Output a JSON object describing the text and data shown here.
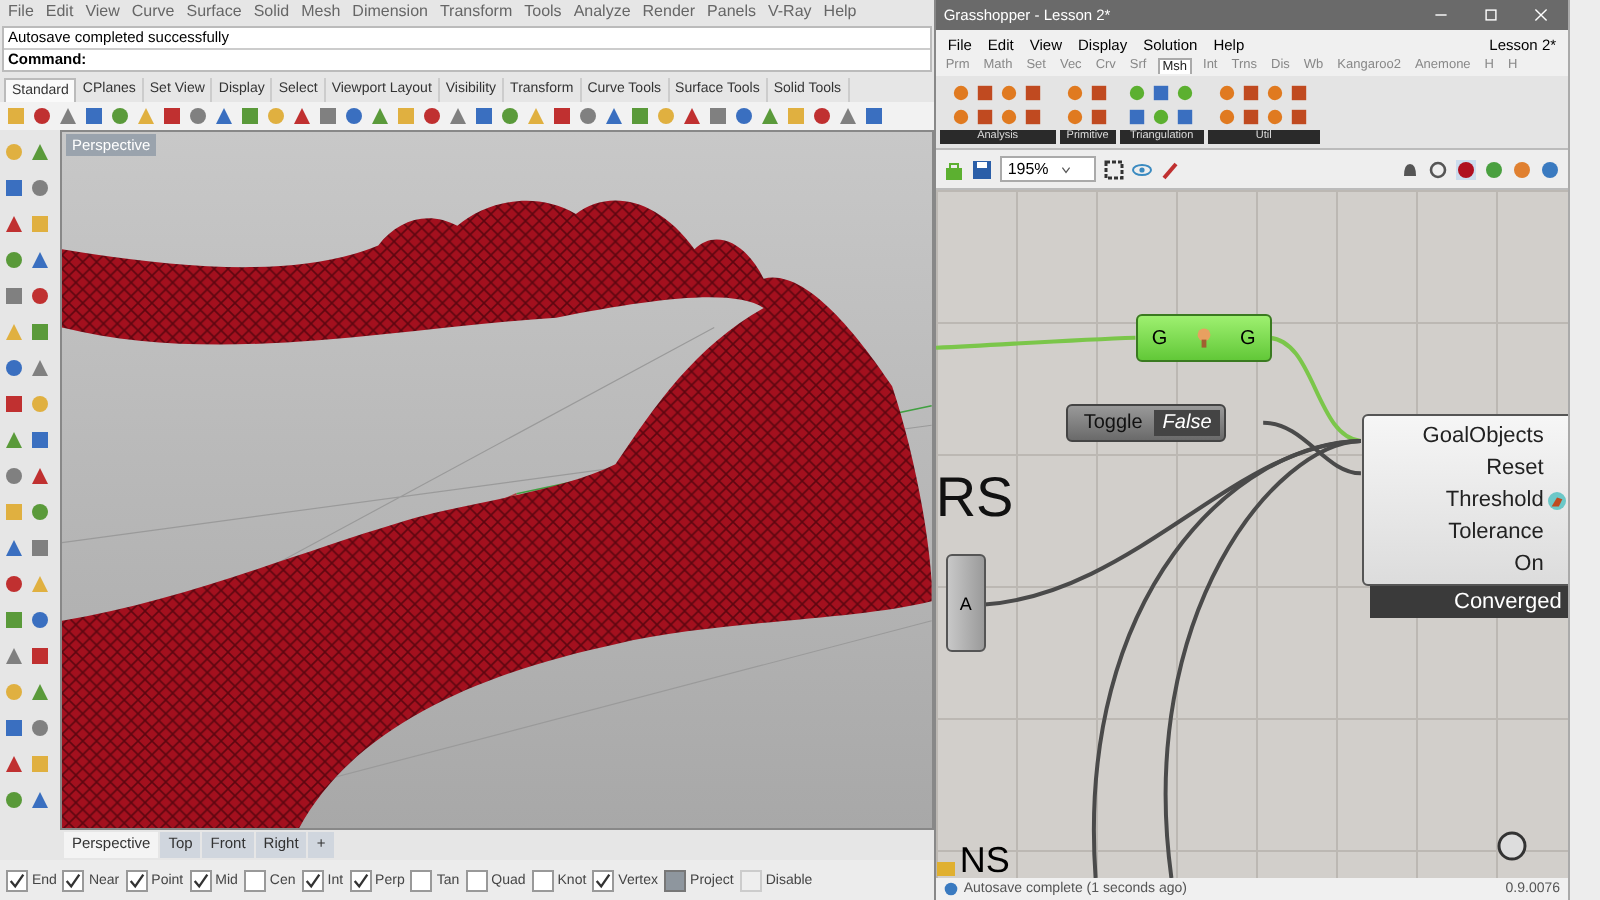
{
  "rhino": {
    "menu": [
      "File",
      "Edit",
      "View",
      "Curve",
      "Surface",
      "Solid",
      "Mesh",
      "Dimension",
      "Transform",
      "Tools",
      "Analyze",
      "Render",
      "Panels",
      "V-Ray",
      "Help"
    ],
    "command_history": "Autosave completed successfully",
    "command_prompt": "Command:",
    "toolbar_tabs": [
      {
        "label": "Standard",
        "selected": true
      },
      {
        "label": "CPlanes",
        "selected": false
      },
      {
        "label": "Set View",
        "selected": false
      },
      {
        "label": "Display",
        "selected": false
      },
      {
        "label": "Select",
        "selected": false
      },
      {
        "label": "Viewport Layout",
        "selected": false
      },
      {
        "label": "Visibility",
        "selected": false
      },
      {
        "label": "Transform",
        "selected": false
      },
      {
        "label": "Curve Tools",
        "selected": false
      },
      {
        "label": "Surface Tools",
        "selected": false
      },
      {
        "label": "Solid Tools",
        "selected": false
      }
    ],
    "viewport": {
      "title": "Perspective"
    },
    "viewport_tabs": [
      {
        "label": "Perspective",
        "selected": true
      },
      {
        "label": "Top",
        "selected": false
      },
      {
        "label": "Front",
        "selected": false
      },
      {
        "label": "Right",
        "selected": false
      },
      {
        "label": "+",
        "selected": false
      }
    ],
    "osnaps": [
      {
        "label": "End",
        "checked": true,
        "kind": "checkbox"
      },
      {
        "label": "Near",
        "checked": true,
        "kind": "checkbox"
      },
      {
        "label": "Point",
        "checked": true,
        "kind": "checkbox"
      },
      {
        "label": "Mid",
        "checked": true,
        "kind": "checkbox"
      },
      {
        "label": "Cen",
        "checked": false,
        "kind": "checkbox"
      },
      {
        "label": "Int",
        "checked": true,
        "kind": "checkbox"
      },
      {
        "label": "Perp",
        "checked": true,
        "kind": "checkbox"
      },
      {
        "label": "Tan",
        "checked": false,
        "kind": "checkbox"
      },
      {
        "label": "Quad",
        "checked": false,
        "kind": "checkbox"
      },
      {
        "label": "Knot",
        "checked": false,
        "kind": "checkbox"
      },
      {
        "label": "Vertex",
        "checked": true,
        "kind": "checkbox"
      },
      {
        "label": "Project",
        "checked": true,
        "kind": "toggle"
      },
      {
        "label": "Disable",
        "checked": false,
        "kind": "toggle"
      }
    ]
  },
  "grasshopper": {
    "title": "Grasshopper - Lesson 2*",
    "menu": [
      "File",
      "Edit",
      "View",
      "Display",
      "Solution",
      "Help"
    ],
    "document": "Lesson 2*",
    "tabs": [
      {
        "label": "Prm",
        "selected": false
      },
      {
        "label": "Math",
        "selected": false
      },
      {
        "label": "Set",
        "selected": false
      },
      {
        "label": "Vec",
        "selected": false
      },
      {
        "label": "Crv",
        "selected": false
      },
      {
        "label": "Srf",
        "selected": false
      },
      {
        "label": "Msh",
        "selected": true
      },
      {
        "label": "Int",
        "selected": false
      },
      {
        "label": "Trns",
        "selected": false
      },
      {
        "label": "Dis",
        "selected": false
      },
      {
        "label": "Wb",
        "selected": false
      },
      {
        "label": "Kangaroo2",
        "selected": false
      },
      {
        "label": "Anemone",
        "selected": false
      },
      {
        "label": "H",
        "selected": false
      },
      {
        "label": "H",
        "selected": false
      }
    ],
    "ribbon_groups": [
      "Analysis",
      "Primitive",
      "Triangulation",
      "Util"
    ],
    "zoom": "195%",
    "canvas": {
      "heading_1": "RS",
      "heading_2": "NS",
      "nodes": [
        {
          "kind": "gate",
          "input": "G",
          "output": "G"
        },
        {
          "kind": "toggle",
          "label": "Toggle",
          "value": "False"
        },
        {
          "kind": "param",
          "label": "A"
        },
        {
          "kind": "solver",
          "inputs": [
            "GoalObjects",
            "Reset",
            "Threshold",
            "Tolerance",
            "On"
          ],
          "output": "Converged"
        }
      ]
    },
    "status": "Autosave complete (1 seconds ago)",
    "version": "0.9.0076"
  }
}
